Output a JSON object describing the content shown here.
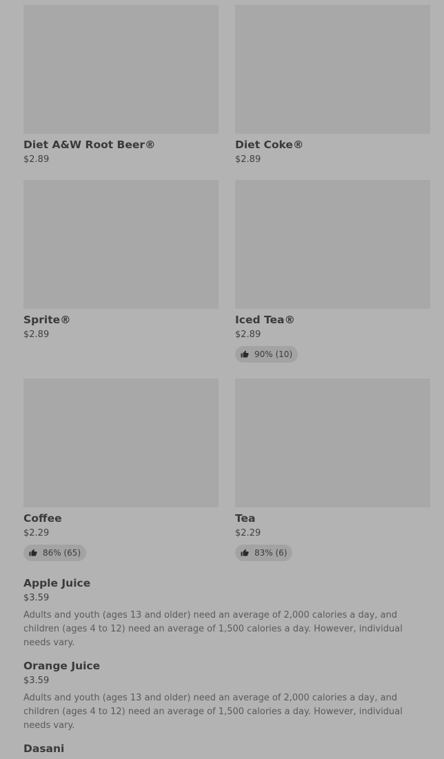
{
  "grid_items": [
    {
      "name": "Diet A&W Root Beer®",
      "price": "$2.89",
      "rating": null
    },
    {
      "name": "Diet Coke®",
      "price": "$2.89",
      "rating": null
    },
    {
      "name": "Sprite®",
      "price": "$2.89",
      "rating": null
    },
    {
      "name": "Iced Tea®",
      "price": "$2.89",
      "rating": "90% (10)"
    },
    {
      "name": "Coffee",
      "price": "$2.29",
      "rating": "86% (65)"
    },
    {
      "name": "Tea",
      "price": "$2.29",
      "rating": "83% (6)"
    }
  ],
  "list_items": [
    {
      "name": "Apple Juice",
      "price": "$3.59",
      "description": "Adults and youth (ages 13 and older) need an average of 2,000 calories a day, and children (ages 4 to 12) need an average of 1,500 calories a day. However, individual needs vary."
    },
    {
      "name": "Orange Juice",
      "price": "$3.59",
      "description": "Adults and youth (ages 13 and older) need an average of 2,000 calories a day, and children (ages 4 to 12) need an average of 1,500 calories a day. However, individual needs vary."
    },
    {
      "name": "Dasani"
    }
  ],
  "icons": {
    "rating": "thumbs-up-icon"
  }
}
